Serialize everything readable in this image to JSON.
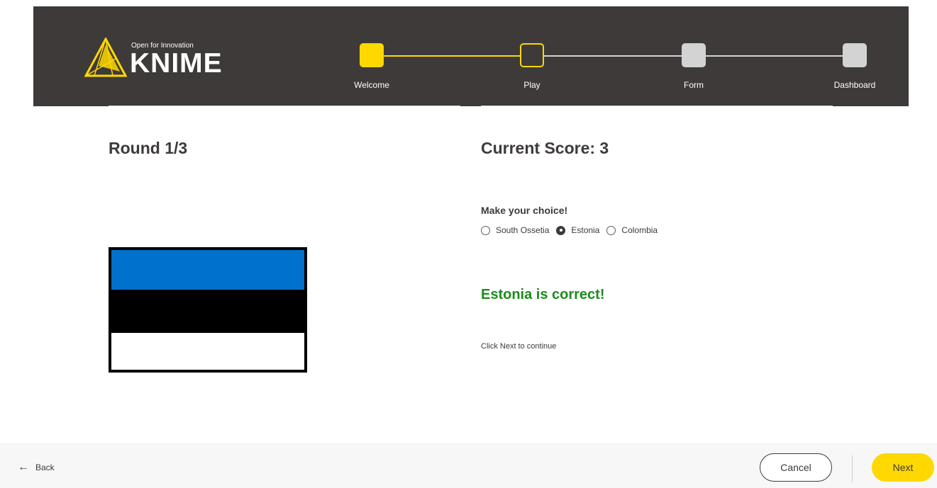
{
  "header": {
    "logo_tagline": "Open for Innovation",
    "logo_word": "KNIME",
    "steps": [
      {
        "label": "Welcome",
        "state": "done"
      },
      {
        "label": "Play",
        "state": "current"
      },
      {
        "label": "Form",
        "state": "todo"
      },
      {
        "label": "Dashboard",
        "state": "todo"
      }
    ]
  },
  "game": {
    "round_title": "Round 1/3",
    "score_title": "Current Score: 3",
    "flag_colors": [
      "#0072ce",
      "#000000",
      "#ffffff"
    ],
    "choice_label": "Make your choice!",
    "options": [
      "South Ossetia",
      "Estonia",
      "Colombia"
    ],
    "selected_option": "Estonia",
    "result_text": "Estonia is correct!",
    "hint_text": "Click Next to continue"
  },
  "footer": {
    "back_label": "Back",
    "cancel_label": "Cancel",
    "next_label": "Next"
  },
  "colors": {
    "brand_yellow": "#ffd800",
    "banner_bg": "#3e3a39",
    "success_green": "#1c8c1c"
  }
}
